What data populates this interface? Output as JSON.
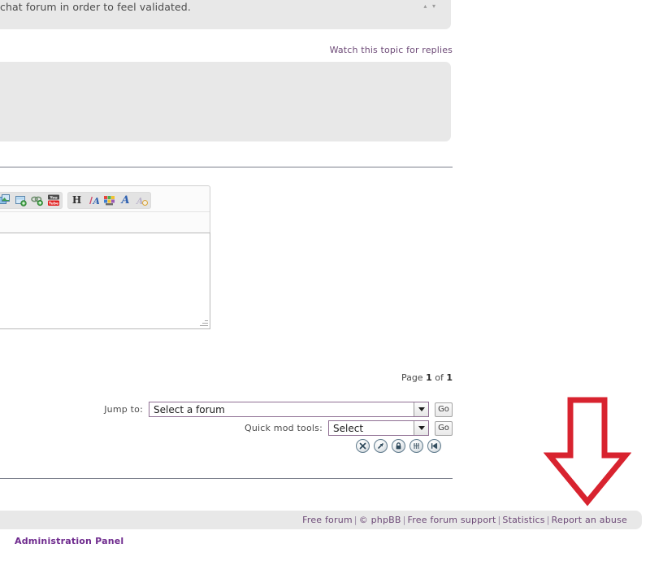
{
  "post": {
    "body_text": "chat forum in order to feel validated.",
    "scroll_up_icon": "chevron-up-icon",
    "scroll_down_icon": "chevron-down-icon",
    "updown_glyphs": "▴ ▾"
  },
  "watch": {
    "link_label": "Watch this topic for replies"
  },
  "editor": {
    "media_buttons": [
      {
        "name": "insert-image-icon",
        "title": "Image"
      },
      {
        "name": "insert-file-icon",
        "title": "Insert file"
      },
      {
        "name": "insert-link-icon",
        "title": "Link"
      },
      {
        "name": "youtube-icon",
        "title": "YouTube",
        "label": "You Tube"
      }
    ],
    "format_buttons": [
      {
        "name": "heading-icon",
        "glyph": "H",
        "style": "glyph-h"
      },
      {
        "name": "italic-color-icon",
        "glyph": "ИA",
        "style": "glyph-ia"
      },
      {
        "name": "font-color-icon",
        "glyph": "",
        "style": ""
      },
      {
        "name": "font-style-icon",
        "glyph": "A",
        "style": "glyph-a-blue"
      },
      {
        "name": "remove-format-icon",
        "glyph": "A",
        "style": "glyph-a-fade"
      }
    ],
    "textarea_value": ""
  },
  "pagination": {
    "prefix": "Page",
    "current": "1",
    "middle": "of",
    "total": "1"
  },
  "jump_to": {
    "label": "Jump to:",
    "selected": "Select a forum",
    "go_label": "Go"
  },
  "quick_mod": {
    "label": "Quick mod tools:",
    "selected": "Select",
    "go_label": "Go"
  },
  "mod_icons": [
    {
      "name": "delete-topic-icon",
      "glyph": "✕"
    },
    {
      "name": "move-topic-icon",
      "glyph": "↗"
    },
    {
      "name": "lock-topic-icon",
      "glyph": "🔒"
    },
    {
      "name": "merge-topic-icon",
      "glyph": "↕"
    },
    {
      "name": "split-topic-icon",
      "glyph": "⏭"
    }
  ],
  "footer": {
    "links": [
      "Free forum",
      "© phpBB",
      "Free forum support",
      "Statistics",
      "Report an abuse"
    ],
    "separator": "|"
  },
  "admin": {
    "label": "Administration Panel"
  },
  "annotation": {
    "arrow_name": "red-down-arrow-annotation",
    "arrow_color": "#d8232f",
    "direction": "down"
  },
  "colors": {
    "link_purple": "#6d4a77",
    "admin_purple": "#6f2b8e",
    "panel_gray": "#e8e8e8",
    "rule_gray": "#7b7f8c",
    "select_border": "#8f6f93",
    "annotation_red": "#d8232f"
  }
}
